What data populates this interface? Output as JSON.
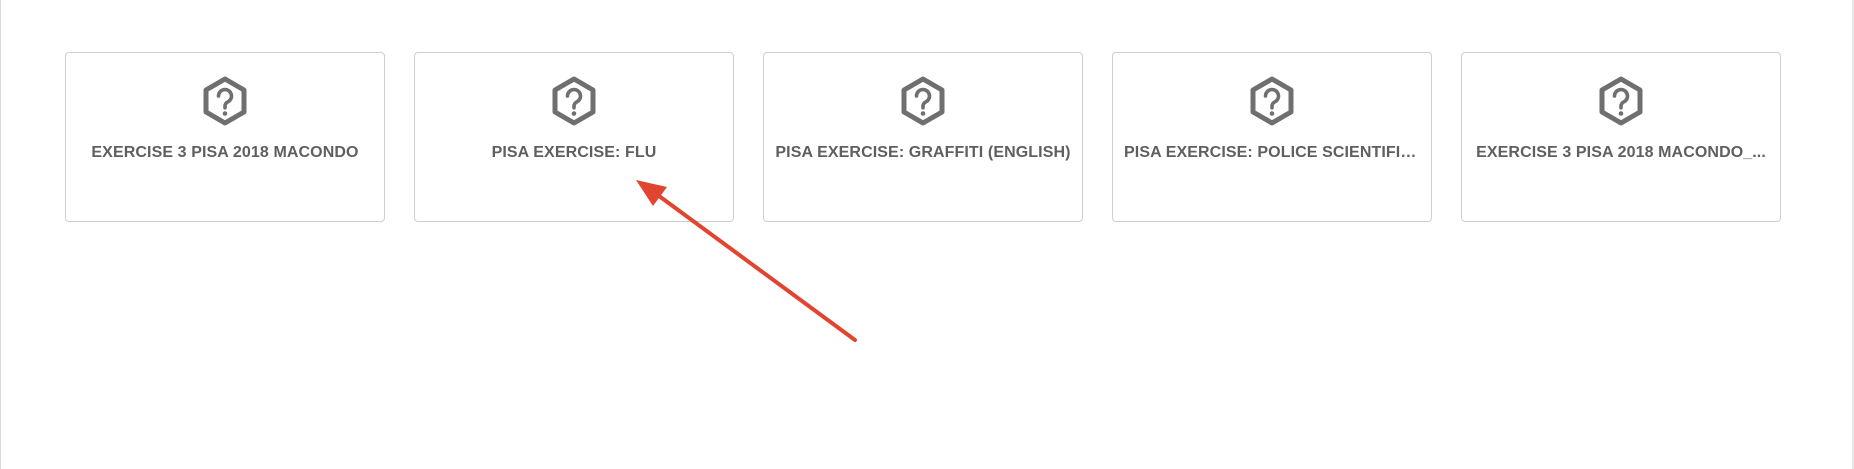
{
  "cards": [
    {
      "icon": "question-hexagon-icon",
      "title": "EXERCISE 3 PISA 2018 MACONDO"
    },
    {
      "icon": "question-hexagon-icon",
      "title": "PISA EXERCISE: FLU"
    },
    {
      "icon": "question-hexagon-icon",
      "title": "PISA EXERCISE: GRAFFITI (ENGLISH)"
    },
    {
      "icon": "question-hexagon-icon",
      "title": "PISA EXERCISE: POLICE SCIENTIFIC..."
    },
    {
      "icon": "question-hexagon-icon",
      "title": "EXERCISE 3 PISA 2018 MACONDO_..."
    }
  ],
  "colors": {
    "card_border": "#cfcfcf",
    "icon": "#6f6f6f",
    "title": "#5f5f5f",
    "annotation_arrow": "#e2452f"
  }
}
